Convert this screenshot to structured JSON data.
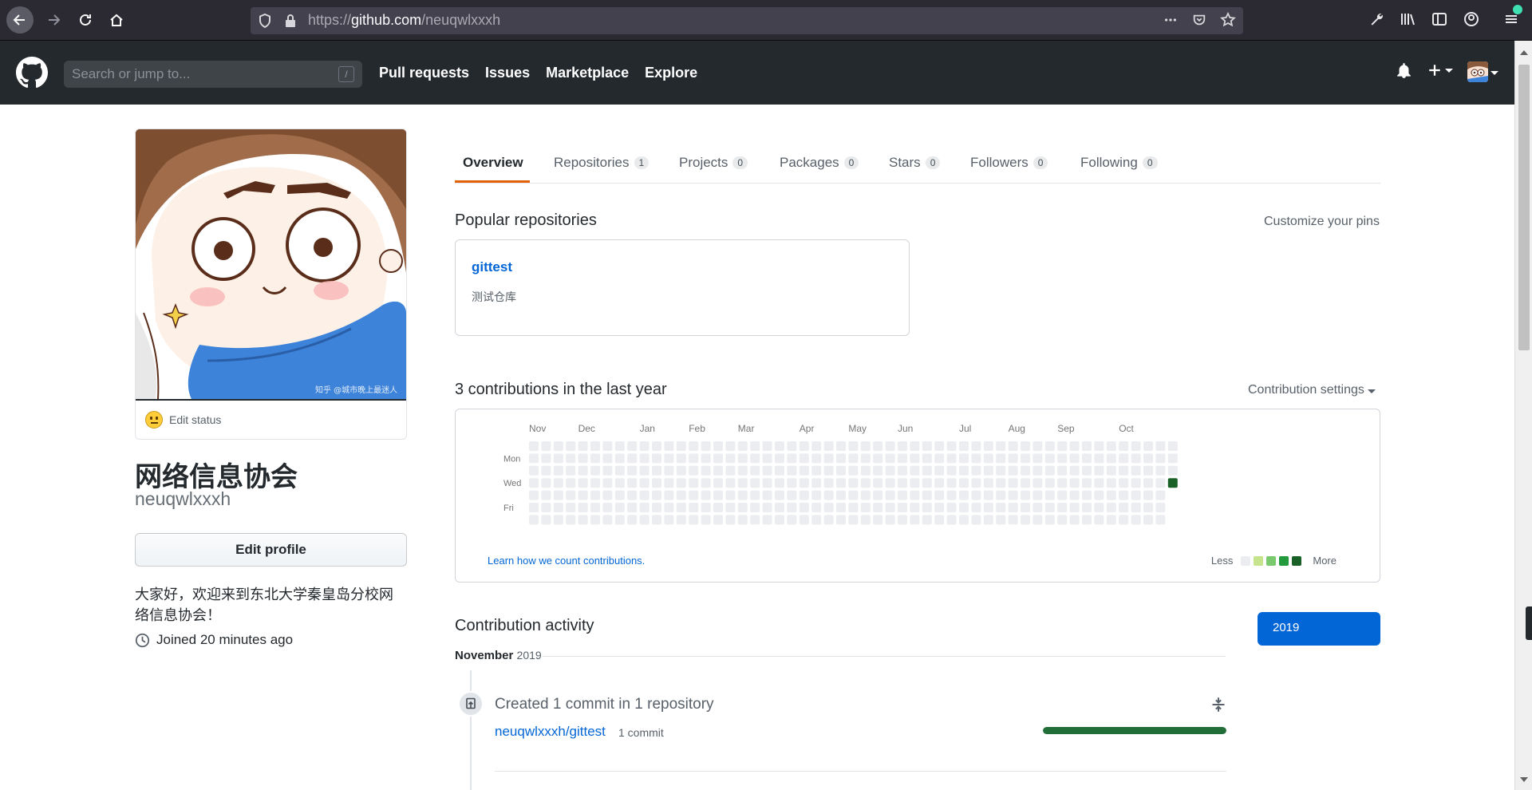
{
  "browser": {
    "url_proto": "https://",
    "url_host": "github.com",
    "url_path": "/neuqwlxxxh",
    "icons": [
      "back-icon",
      "forward-icon",
      "reload-icon",
      "home-icon",
      "shield-icon",
      "lock-icon",
      "more-icon",
      "pocket-icon",
      "bookmark-star-icon",
      "wrench-icon",
      "library-icon",
      "sidebar-icon",
      "account-icon",
      "menu-icon"
    ]
  },
  "header": {
    "search_placeholder": "Search or jump to...",
    "search_hotkey": "/",
    "nav": [
      "Pull requests",
      "Issues",
      "Marketplace",
      "Explore"
    ]
  },
  "profile": {
    "avatar_watermark": "知乎 @城市晚上最迷人",
    "status": "Edit status",
    "name": "网络信息协会",
    "login": "neuqwlxxxh",
    "edit_button": "Edit profile",
    "bio": "大家好，欢迎来到东北大学秦皇岛分校网络信息协会！",
    "joined": "Joined 20 minutes ago"
  },
  "tabs": [
    {
      "label": "Overview",
      "count": ""
    },
    {
      "label": "Repositories",
      "count": "1"
    },
    {
      "label": "Projects",
      "count": "0"
    },
    {
      "label": "Packages",
      "count": "0"
    },
    {
      "label": "Stars",
      "count": "0"
    },
    {
      "label": "Followers",
      "count": "0"
    },
    {
      "label": "Following",
      "count": "0"
    }
  ],
  "popular": {
    "heading": "Popular repositories",
    "customize": "Customize your pins",
    "repo_name": "gittest",
    "repo_desc": "测试仓库"
  },
  "contributions": {
    "heading": "3 contributions in the last year",
    "settings": "Contribution settings",
    "months": [
      "Nov",
      "Dec",
      "Jan",
      "Feb",
      "Mar",
      "Apr",
      "May",
      "Jun",
      "Jul",
      "Aug",
      "Sep",
      "Oct"
    ],
    "days": [
      "Mon",
      "Wed",
      "Fri"
    ],
    "learn_link": "Learn how we count contributions.",
    "legend_less": "Less",
    "legend_more": "More",
    "colors": [
      "#ebedf0",
      "#c6e48b",
      "#7bc96f",
      "#239a3b",
      "#196127"
    ],
    "weeks": 53,
    "active_cell": {
      "week": 52,
      "day": 3,
      "level": 4
    }
  },
  "activity": {
    "heading": "Contribution activity",
    "year_button": "2019",
    "month": "November",
    "month_year": "2019",
    "summary": "Created 1 commit in 1 repository",
    "repo": "neuqwlxxxh/gittest",
    "commits": "1 commit",
    "progress": 1.0
  }
}
